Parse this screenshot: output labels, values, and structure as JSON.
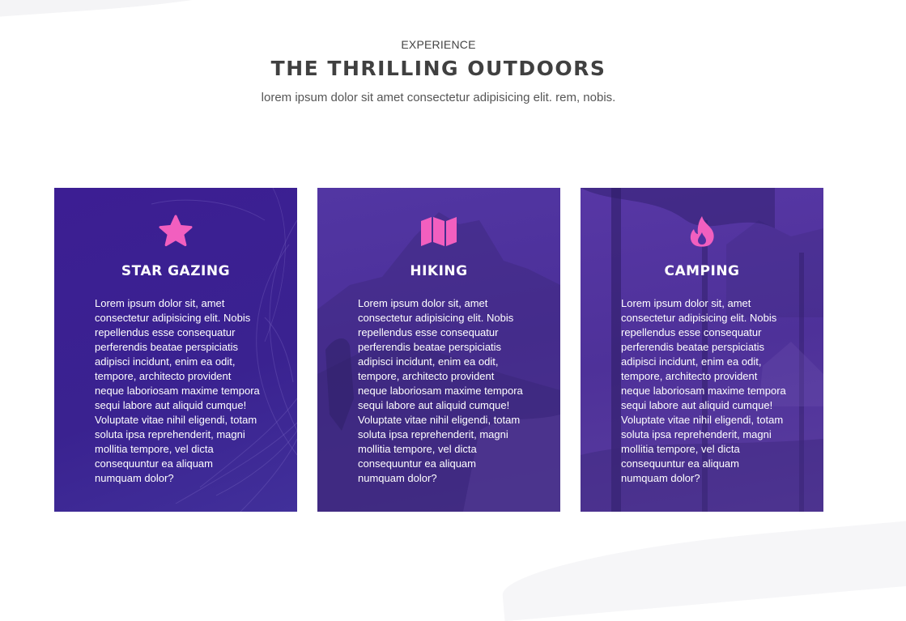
{
  "section": {
    "eyebrow": "EXPERIENCE",
    "title": "THE THRILLING OUTDOORS",
    "subtitle": "lorem ipsum dolor sit amet consectetur adipisicing elit. rem, nobis."
  },
  "colors": {
    "accent_pink": "#f25fbf",
    "card_purple": "#3c1e93"
  },
  "cards": [
    {
      "icon": "star-icon",
      "title": "STAR GAZING",
      "body": "Lorem ipsum dolor sit, amet consectetur adipisicing elit. Nobis repellendus esse consequatur perferendis beatae perspiciatis adipisci incidunt, enim ea odit, tempore, architecto provident neque laboriosam maxime tempora sequi labore aut aliquid cumque! Voluptate vitae nihil eligendi, totam soluta ipsa reprehenderit, magni mollitia tempore, vel dicta consequuntur ea aliquam numquam dolor?"
    },
    {
      "icon": "map-icon",
      "title": "HIKING",
      "body": "Lorem ipsum dolor sit, amet consectetur adipisicing elit. Nobis repellendus esse consequatur perferendis beatae perspiciatis adipisci incidunt, enim ea odit, tempore, architecto provident neque laboriosam maxime tempora sequi labore aut aliquid cumque! Voluptate vitae nihil eligendi, totam soluta ipsa reprehenderit, magni mollitia tempore, vel dicta consequuntur ea aliquam numquam dolor?"
    },
    {
      "icon": "fire-icon",
      "title": "CAMPING",
      "body": "Lorem ipsum dolor sit, amet consectetur adipisicing elit. Nobis repellendus esse consequatur perferendis beatae perspiciatis adipisci incidunt, enim ea odit, tempore, architecto provident neque laboriosam maxime tempora sequi labore aut aliquid cumque! Voluptate vitae nihil eligendi, totam soluta ipsa reprehenderit, magni mollitia tempore, vel dicta consequuntur ea aliquam numquam dolor?"
    }
  ]
}
